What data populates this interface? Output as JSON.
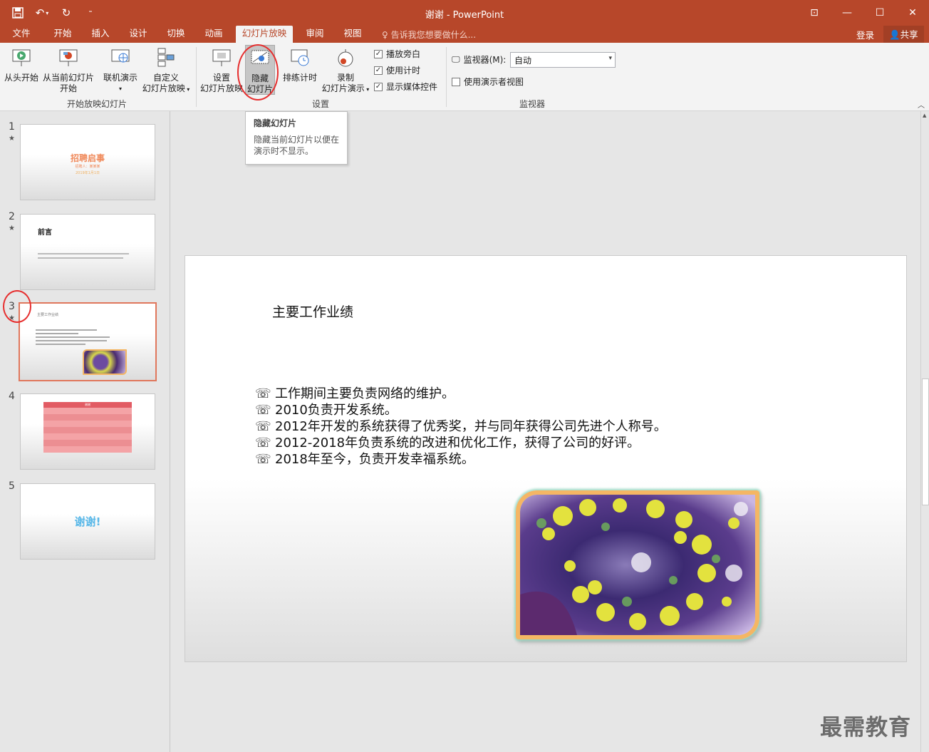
{
  "window": {
    "title": "谢谢 - PowerPoint"
  },
  "tabs": [
    "文件",
    "开始",
    "插入",
    "设计",
    "切换",
    "动画",
    "幻灯片放映",
    "审阅",
    "视图"
  ],
  "tell_me": "告诉我您想要做什么...",
  "account": {
    "login": "登录",
    "share": "共享"
  },
  "ribbon": {
    "start_group": {
      "label": "开始放映幻灯片",
      "from_beginning": "从头开始",
      "from_current_1": "从当前幻灯片",
      "from_current_2": "开始",
      "online": "联机演示",
      "custom_1": "自定义",
      "custom_2": "幻灯片放映"
    },
    "setup_group": {
      "label": "设置",
      "setup_1": "设置",
      "setup_2": "幻灯片放映",
      "hide_1": "隐藏",
      "hide_2": "幻灯片",
      "rehearse": "排练计时",
      "record_1": "录制",
      "record_2": "幻灯片演示",
      "play_narrations": "播放旁白",
      "use_timings": "使用计时",
      "show_media_controls": "显示媒体控件"
    },
    "monitor_group": {
      "label": "监视器",
      "monitor_label": "监视器(M):",
      "monitor_value": "自动",
      "presenter_view": "使用演示者视图"
    }
  },
  "tooltip": {
    "title": "隐藏幻灯片",
    "desc": "隐藏当前幻灯片以便在演示时不显示。"
  },
  "thumbnails": [
    {
      "num": "1",
      "title": "招聘启事",
      "sub1": "招聘人：某某某",
      "sub2": "2019年1月1日"
    },
    {
      "num": "2",
      "title": "前言"
    },
    {
      "num": "3",
      "title": "主要工作业绩"
    },
    {
      "num": "4",
      "title": "谢谢"
    },
    {
      "num": "5",
      "title": "谢谢!"
    }
  ],
  "slide": {
    "title": "主要工作业绩",
    "bullet_symbol": "☏",
    "bullets": [
      "工作期间主要负责网络的维护。",
      "2010负责开发系统。",
      "2012年开发的系统获得了优秀奖，并与同年获得公司先进个人称号。",
      "2012-2018年负责系统的改进和优化工作，获得了公司的好评。",
      "2018年至今，负责开发幸福系统。"
    ]
  },
  "watermark": "最需教育",
  "colors": {
    "accent": "#b7472a",
    "pink": "#f08080",
    "orange_text": "#f0895a"
  }
}
